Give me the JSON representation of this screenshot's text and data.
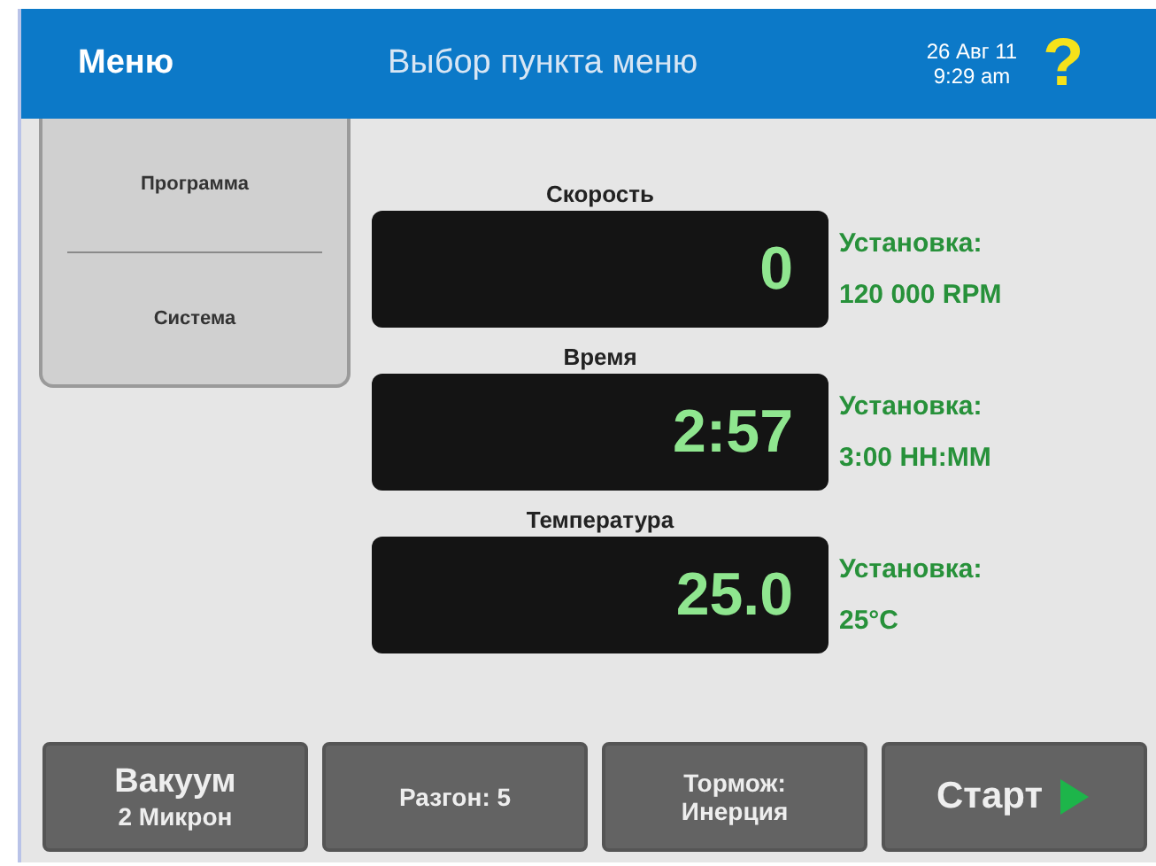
{
  "header": {
    "menu": "Меню",
    "title": "Выбор пункта меню",
    "date": "26 Авг 11",
    "time": "9:29 am",
    "help": "?"
  },
  "menu_items": [
    {
      "label": "Программа"
    },
    {
      "label": "Система"
    }
  ],
  "readings": [
    {
      "label": "Скорость",
      "value": "0",
      "setpoint_label": "Установка:",
      "setpoint_value": "120 000 RPM"
    },
    {
      "label": "Время",
      "value": "2:57",
      "setpoint_label": "Установка:",
      "setpoint_value": "3:00 HH:MM"
    },
    {
      "label": "Температура",
      "value": "25.0",
      "setpoint_label": "Установка:",
      "setpoint_value": "25°C"
    }
  ],
  "buttons": [
    {
      "kind": "large",
      "lines": [
        "Вакуум",
        "2 Микрон"
      ]
    },
    {
      "kind": "small",
      "lines": [
        "Разгон: 5"
      ]
    },
    {
      "kind": "small",
      "lines": [
        "Тормож:",
        "Инерция"
      ]
    },
    {
      "kind": "start",
      "lines": [
        "Старт"
      ]
    }
  ]
}
